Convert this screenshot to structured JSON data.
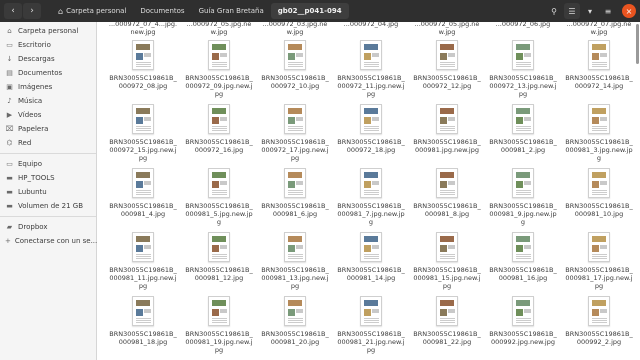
{
  "header": {
    "back_icon": "chevron-left-icon",
    "forward_icon": "chevron-right-icon",
    "breadcrumbs": [
      "Carpeta personal",
      "Documentos",
      "Guía Gran Bretaña",
      "gb02__p041-094"
    ],
    "right_icons": [
      "search-icon",
      "view-list-icon",
      "view-options-icon",
      "menu-icon",
      "close-icon"
    ]
  },
  "sidebar": {
    "places": [
      {
        "label": "Carpeta personal",
        "icon": "home-icon"
      },
      {
        "label": "Escritorio",
        "icon": "desktop-icon"
      },
      {
        "label": "Descargas",
        "icon": "download-icon"
      },
      {
        "label": "Documentos",
        "icon": "document-icon"
      },
      {
        "label": "Imágenes",
        "icon": "image-icon"
      },
      {
        "label": "Música",
        "icon": "music-icon"
      },
      {
        "label": "Vídeos",
        "icon": "video-icon"
      },
      {
        "label": "Papelera",
        "icon": "trash-icon"
      },
      {
        "label": "Red",
        "icon": "network-icon"
      }
    ],
    "devices": [
      {
        "label": "Equipo",
        "icon": "computer-icon"
      },
      {
        "label": "HP_TOOLS",
        "icon": "drive-icon"
      },
      {
        "label": "Lubuntu",
        "icon": "drive-icon"
      },
      {
        "label": "Volumen de 21 GB",
        "icon": "drive-icon"
      }
    ],
    "cloud": [
      {
        "label": "Dropbox",
        "icon": "folder-icon"
      },
      {
        "label": "Conectarse con un se...",
        "icon": "plus-icon"
      }
    ]
  },
  "files": {
    "row0": [
      "...000972_07_4...jpg.new.jpg",
      "...000972_05.jpg.new.jpg",
      "...000972_03.jpg.new.jpg",
      "...000972_04.jpg",
      "...000972_05.jpg.new.jpg",
      "...000972_06.jpg",
      "...000972_07.jpg.new.jpg"
    ],
    "rows": [
      [
        "BRN30055C19861B_000972_08.jpg",
        "BRN30055C19861B_000972_09.jpg.new.jpg",
        "BRN30055C19861B_000972_10.jpg",
        "BRN30055C19861B_000972_11.jpg.new.jpg",
        "BRN30055C19861B_000972_12.jpg",
        "BRN30055C19861B_000972_13.jpg.new.jpg",
        "BRN30055C19861B_000972_14.jpg"
      ],
      [
        "BRN30055C19861B_000972_15.jpg.new.jpg",
        "BRN30055C19861B_000972_16.jpg",
        "BRN30055C19861B_000972_17.jpg.new.jpg",
        "BRN30055C19861B_000972_18.jpg",
        "BRN30055C19861B_000981.jpg.new.jpg",
        "BRN30055C19861B_000981_2.jpg",
        "BRN30055C19861B_000981_3.jpg.new.jpg"
      ],
      [
        "BRN30055C19861B_000981_4.jpg",
        "BRN30055C19861B_000981_5.jpg.new.jpg",
        "BRN30055C19861B_000981_6.jpg",
        "BRN30055C19861B_000981_7.jpg.new.jpg",
        "BRN30055C19861B_000981_8.jpg",
        "BRN30055C19861B_000981_9.jpg.new.jpg",
        "BRN30055C19861B_000981_10.jpg"
      ],
      [
        "BRN30055C19861B_000981_11.jpg.new.jpg",
        "BRN30055C19861B_000981_12.jpg",
        "BRN30055C19861B_000981_13.jpg.new.jpg",
        "BRN30055C19861B_000981_14.jpg",
        "BRN30055C19861B_000981_15.jpg.new.jpg",
        "BRN30055C19861B_000981_16.jpg",
        "BRN30055C19861B_000981_17.jpg.new.jpg"
      ],
      [
        "BRN30055C19861B_000981_18.jpg",
        "BRN30055C19861B_000981_19.jpg.new.jpg",
        "BRN30055C19861B_000981_20.jpg",
        "BRN30055C19861B_000981_21.jpg.new.jpg",
        "BRN30055C19861B_000981_22.jpg",
        "BRN30055C19861B_000992.jpg.new.jpg",
        "BRN30055C19861B_000992_2.jpg"
      ]
    ]
  },
  "colors": {
    "header_bg": "#2f2f2f",
    "sidebar_bg": "#f5f5f5",
    "close_button": "#e95420",
    "thumb_accents": [
      "#8a7a5a",
      "#6f8f5a",
      "#b58a5a",
      "#5a7a9a",
      "#9a6a4a",
      "#7a9a7a",
      "#c0a060"
    ]
  }
}
